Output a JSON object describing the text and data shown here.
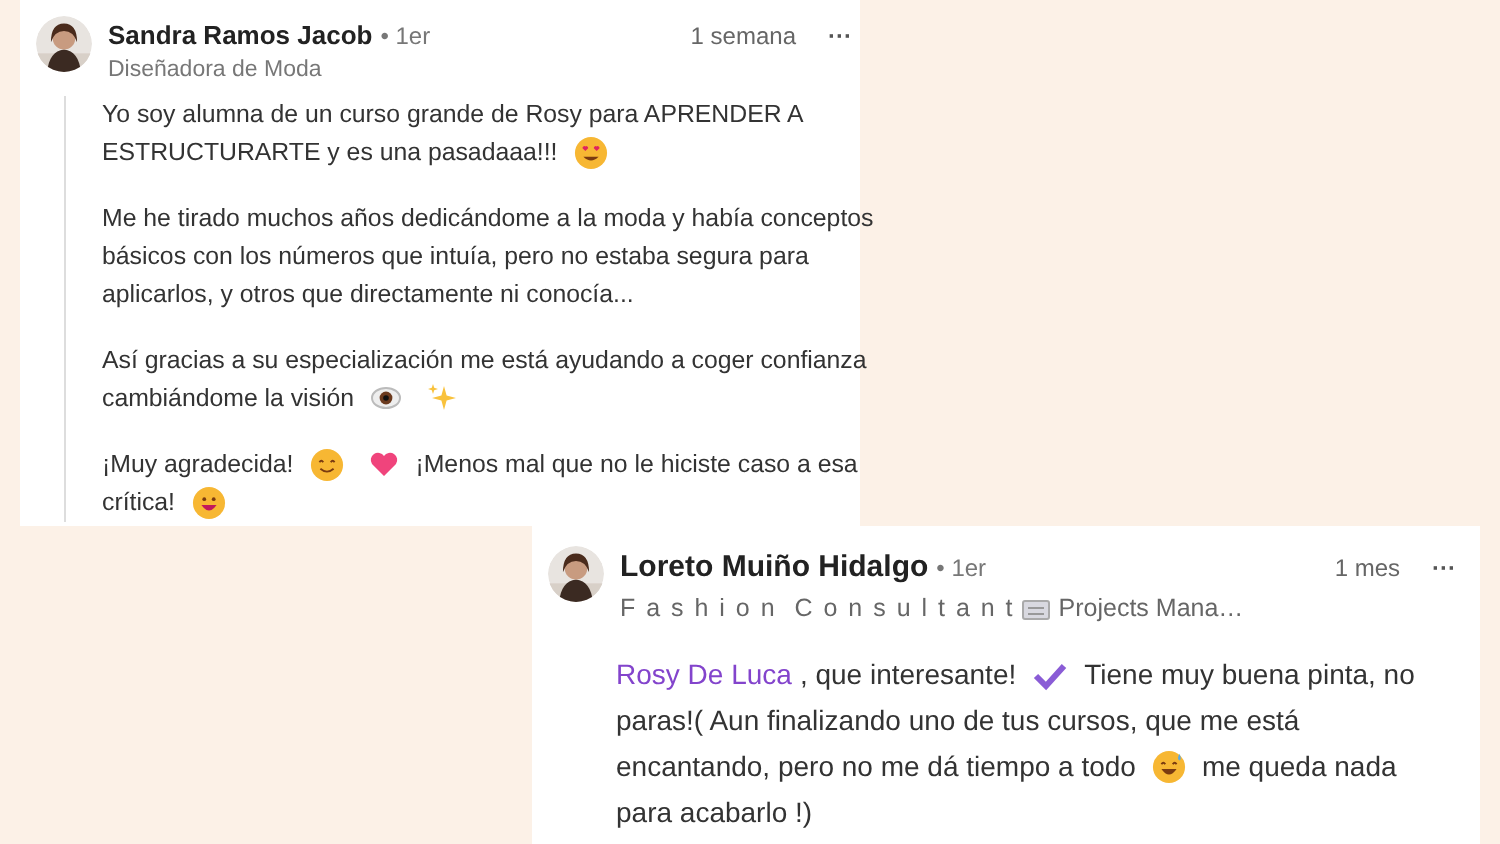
{
  "comments": [
    {
      "author": "Sandra Ramos Jacob",
      "degree": "• 1er",
      "headline": [
        {
          "kind": "text",
          "text": "Diseñadora de Moda"
        }
      ],
      "time": "1 semana",
      "more": "···",
      "avatar": {
        "kind": "picture"
      },
      "paragraphs": [
        [
          [
            {
              "kind": "text",
              "text": "Yo soy alumna de un curso grande de Rosy para APRENDER A"
            }
          ],
          [
            {
              "kind": "text",
              "text": "ESTRUCTURARTE y es una pasadaaa!!!"
            },
            {
              "kind": "heart_eyes"
            }
          ]
        ],
        [
          [
            {
              "kind": "text",
              "text": "Me he tirado muchos años dedicándome a la moda y había conceptos"
            }
          ],
          [
            {
              "kind": "text",
              "text": "básicos con los números que intuía, pero no estaba segura para"
            }
          ],
          [
            {
              "kind": "text",
              "text": "aplicarlos, y otros que directamente ni conocía..."
            }
          ]
        ],
        [
          [
            {
              "kind": "text",
              "text": "Así gracias a su especialización me está ayudando a coger confianza"
            }
          ],
          [
            {
              "kind": "text",
              "text": "cambiándome la visión"
            },
            {
              "kind": "eye"
            },
            {
              "kind": "sparkles"
            }
          ]
        ],
        [
          [
            {
              "kind": "text",
              "text": "¡Muy agradecida!"
            },
            {
              "kind": "smile"
            },
            {
              "kind": "heart"
            },
            {
              "kind": "text",
              "text": "¡Menos mal que no le hiciste caso a esa"
            }
          ],
          [
            {
              "kind": "text",
              "text": "crítica!"
            },
            {
              "kind": "grin"
            }
          ]
        ]
      ]
    },
    {
      "author": "Loreto Muiño Hidalgo",
      "degree": "• 1er",
      "headline": [
        {
          "kind": "spaced",
          "text": "F a s h i o n  C o n s u l t a n t"
        },
        {
          "kind": "keyboard"
        },
        {
          "kind": "text",
          "text": "Projects Mana…"
        }
      ],
      "time": "1 mes",
      "more": "···",
      "avatar": {
        "kind": "picture"
      },
      "paragraphs": [
        [
          [
            {
              "kind": "mention",
              "text": "Rosy De Luca"
            },
            {
              "kind": "text",
              "text": ", que interesante!"
            },
            {
              "kind": "check"
            },
            {
              "kind": "text",
              "text": "Tiene muy buena pinta, no"
            }
          ],
          [
            {
              "kind": "text",
              "text": "paras!( Aun finalizando uno de tus cursos, que me está"
            }
          ],
          [
            {
              "kind": "text",
              "text": "encantando, pero no me dá tiempo a todo"
            },
            {
              "kind": "sweat_grin"
            },
            {
              "kind": "text",
              "text": "me queda nada"
            }
          ],
          [
            {
              "kind": "text",
              "text": "para acabarlo !)"
            }
          ]
        ]
      ]
    }
  ]
}
